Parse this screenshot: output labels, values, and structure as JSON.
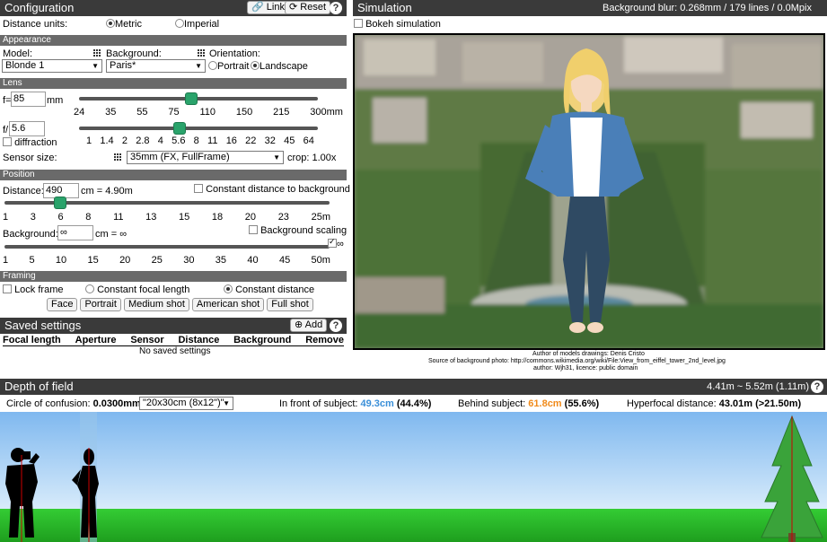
{
  "config": {
    "title": "Configuration",
    "link_label": "Link",
    "reset_label": "Reset",
    "help": "?",
    "units_label": "Distance units:",
    "metric_label": "Metric",
    "imperial_label": "Imperial",
    "units_selected": "Metric"
  },
  "appearance": {
    "title": "Appearance",
    "model_label": "Model:",
    "model_value": "Blonde 1",
    "background_label": "Background:",
    "background_value": "Paris*",
    "orientation_label": "Orientation:",
    "portrait_label": "Portrait",
    "landscape_label": "Landscape",
    "orientation_selected": "Landscape"
  },
  "lens": {
    "title": "Lens",
    "focal_prefix": "f=",
    "focal_value": "85",
    "focal_unit": "mm",
    "focal_ticks": [
      "24",
      "35",
      "55",
      "75",
      "110",
      "150",
      "215",
      "300mm"
    ],
    "aperture_prefix": "f/",
    "aperture_value": "5.6",
    "diffraction_label": "diffraction",
    "aperture_ticks": [
      "1",
      "1.4",
      "2",
      "2.8",
      "4",
      "5.6",
      "8",
      "11",
      "16",
      "22",
      "32",
      "45",
      "64"
    ],
    "sensor_label": "Sensor size:",
    "sensor_value": "35mm (FX, FullFrame)",
    "crop_label": "crop: 1.00x"
  },
  "position": {
    "title": "Position",
    "distance_label": "Distance:",
    "distance_value": "490",
    "distance_suffix": "cm = 4.90m",
    "constant_bg_label": "Constant distance to background",
    "distance_ticks": [
      "1",
      "3",
      "6",
      "8",
      "11",
      "13",
      "15",
      "18",
      "20",
      "23",
      "25m"
    ],
    "background_label": "Background:",
    "background_value": "∞",
    "background_suffix": "cm = ∞",
    "bg_scaling_label": "Background scaling",
    "infinity_label": "∞",
    "background_ticks": [
      "1",
      "5",
      "10",
      "15",
      "20",
      "25",
      "30",
      "35",
      "40",
      "45",
      "50m"
    ]
  },
  "framing": {
    "title": "Framing",
    "lock_label": "Lock frame",
    "constant_focal_label": "Constant focal length",
    "constant_distance_label": "Constant distance",
    "buttons": [
      "Face",
      "Portrait",
      "Medium shot",
      "American shot",
      "Full shot"
    ]
  },
  "saved": {
    "title": "Saved settings",
    "add_label": "Add",
    "columns": [
      "Focal length",
      "Aperture",
      "Sensor",
      "Distance",
      "Background",
      "Remove"
    ],
    "empty_text": "No saved settings"
  },
  "simulation": {
    "title": "Simulation",
    "blur_text": "Background blur: 0.268mm / 179 lines / 0.0Mpix",
    "bokeh_label": "Bokeh simulation",
    "credit_1": "Author of models drawings: Denis Cristo",
    "credit_2": "Source of background photo: http://commons.wikimedia.org/wiki/File:View_from_eiffel_tower_2nd_level.jpg",
    "credit_3": "author: Wjh31, licence: public domain"
  },
  "dof": {
    "title": "Depth of field",
    "range_text": "4.41m ~ 5.52m (1.11m)",
    "coc_label": "Circle of confusion:",
    "coc_value": "0.0300mm",
    "coc_select": "\"20x30cm (8x12\")\"",
    "front_label": "In front of subject:",
    "front_value": "49.3cm",
    "front_pct": "(44.4%)",
    "behind_label": "Behind subject:",
    "behind_value": "61.8cm",
    "behind_pct": "(55.6%)",
    "hyper_label": "Hyperfocal distance:",
    "hyper_value": "43.01m (>21.50m)"
  },
  "colors": {
    "front": "#3a8fd8",
    "behind": "#f08a1a",
    "knob": "#2aa36b"
  },
  "sliders": {
    "focal_fraction": 0.47,
    "aperture_fraction": 0.42,
    "distance_fraction": 0.17,
    "background_fraction": 1.0
  }
}
